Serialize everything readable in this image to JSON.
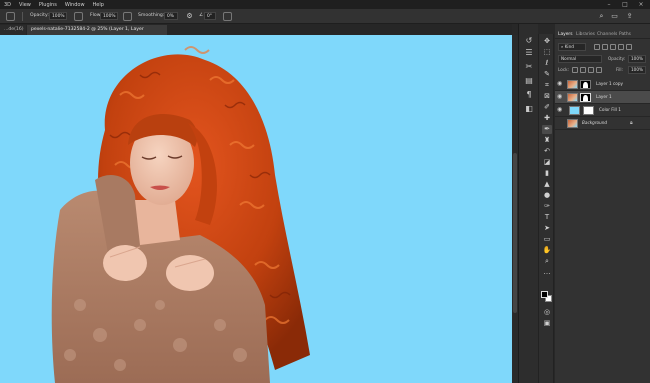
{
  "menu": [
    "3D",
    "View",
    "Plugins",
    "Window",
    "Help"
  ],
  "options_bar": {
    "opacity_label": "Opacity:",
    "opacity_value": "100%",
    "flow_label": "Flow:",
    "flow_value": "100%",
    "smoothing_label": "Smoothing:",
    "smoothing_value": "0%",
    "angle_value": "0°"
  },
  "tabs": [
    {
      "label": "...de(16) *"
    },
    {
      "label": "pexels-natalie-7132584-2 @ 25% (Layer 1, Layer Mask/16) *"
    }
  ],
  "canvas": {
    "background_color": "#7fd8fb",
    "subject": "woman with red curly hair in beige fleece jacket"
  },
  "layers_panel": {
    "tabs": [
      "Layers",
      "Libraries",
      "Channels",
      "Paths"
    ],
    "kind_label": "Kind",
    "blend_mode": "Normal",
    "opacity_label": "Opacity:",
    "opacity_value": "100%",
    "lock_label": "Lock:",
    "fill_label": "Fill:",
    "fill_value": "100%",
    "layers": [
      {
        "name": "Layer 1 copy",
        "thumb": "image",
        "mask": true,
        "selected": false
      },
      {
        "name": "Layer 1",
        "thumb": "image",
        "mask": true,
        "selected": true
      },
      {
        "name": "Color Fill 1",
        "thumb": "fill",
        "mask": true,
        "selected": false
      },
      {
        "name": "Background",
        "thumb": "image",
        "mask": false,
        "selected": false,
        "locked": true
      }
    ]
  },
  "colors": {
    "foreground": "#000000",
    "background": "#ffffff",
    "canvas_bg": "#7fd8fb"
  }
}
